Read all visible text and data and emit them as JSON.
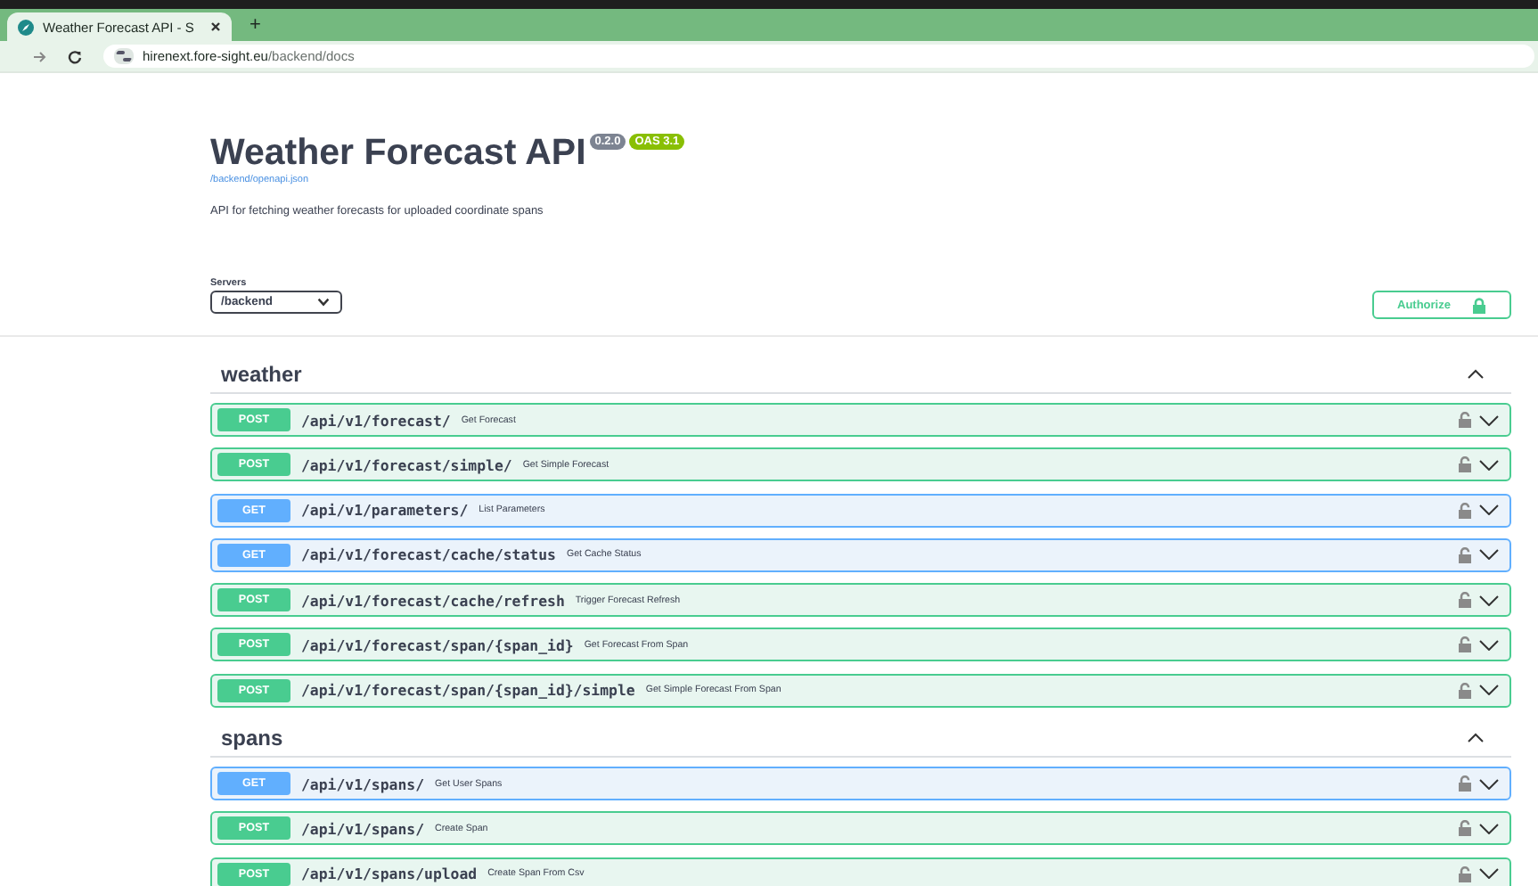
{
  "browser": {
    "tabs": [
      {
        "title": "Weather Forecast API - S",
        "selected": true
      }
    ],
    "new_tab": "+",
    "url_host": "hirenext.fore-sight.eu",
    "url_path": "/backend/docs"
  },
  "info": {
    "title": "Weather Forecast API",
    "version": "0.2.0",
    "oas": "OAS 3.1",
    "spec_link": "/backend/openapi.json",
    "description": "API for fetching weather forecasts for uploaded coordinate spans"
  },
  "servers": {
    "label": "Servers",
    "value": "/backend"
  },
  "authorize": {
    "label": "Authorize"
  },
  "tags": [
    {
      "name": "weather",
      "expanded": true,
      "operations": [
        {
          "method": "POST",
          "path": "/api/v1/forecast/",
          "summary": "Get Forecast"
        },
        {
          "method": "POST",
          "path": "/api/v1/forecast/simple/",
          "summary": "Get Simple Forecast"
        },
        {
          "method": "GET",
          "path": "/api/v1/parameters/",
          "summary": "List Parameters"
        },
        {
          "method": "GET",
          "path": "/api/v1/forecast/cache/status",
          "summary": "Get Cache Status"
        },
        {
          "method": "POST",
          "path": "/api/v1/forecast/cache/refresh",
          "summary": "Trigger Forecast Refresh"
        },
        {
          "method": "POST",
          "path": "/api/v1/forecast/span/{span_id}",
          "summary": "Get Forecast From Span"
        },
        {
          "method": "POST",
          "path": "/api/v1/forecast/span/{span_id}/simple",
          "summary": "Get Simple Forecast From Span"
        }
      ]
    },
    {
      "name": "spans",
      "expanded": true,
      "operations": [
        {
          "method": "GET",
          "path": "/api/v1/spans/",
          "summary": "Get User Spans"
        },
        {
          "method": "POST",
          "path": "/api/v1/spans/",
          "summary": "Create Span"
        },
        {
          "method": "POST",
          "path": "/api/v1/spans/upload",
          "summary": "Create Span From Csv"
        }
      ]
    }
  ]
}
